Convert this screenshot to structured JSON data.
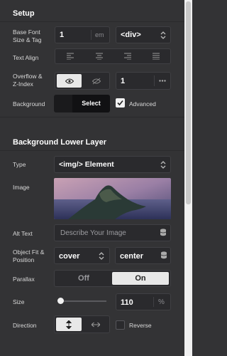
{
  "setup": {
    "title": "Setup",
    "font_size_label": "Base Font\nSize & Tag",
    "font_size_value": "1",
    "font_size_unit": "em",
    "tag_value": "<div>",
    "text_align_label": "Text Align",
    "overflow_label": "Overflow &\nZ-Index",
    "z_index_value": "1",
    "background_label": "Background",
    "select_label": "Select",
    "advanced_label": "Advanced"
  },
  "lower_layer": {
    "title": "Background Lower Layer",
    "type_label": "Type",
    "type_value": "<img/> Element",
    "image_label": "Image",
    "alt_label": "Alt Text",
    "alt_placeholder": "Describe Your Image",
    "fit_label": "Object Fit &\nPosition",
    "fit_value": "cover",
    "position_value": "center",
    "parallax_label": "Parallax",
    "parallax_off": "Off",
    "parallax_on": "On",
    "size_label": "Size",
    "size_value": "110",
    "size_unit": "%",
    "size_slider_fraction": 0.05,
    "direction_label": "Direction",
    "reverse_label": "Reverse"
  },
  "icons": [
    "chevron-updown-icon",
    "align-left-icon",
    "align-center-icon",
    "align-right-icon",
    "align-justify-icon",
    "eye-icon",
    "eye-slash-icon",
    "ellipsis-icon",
    "checkmark-icon",
    "database-icon",
    "vertical-arrows-icon",
    "horizontal-arrows-icon"
  ]
}
